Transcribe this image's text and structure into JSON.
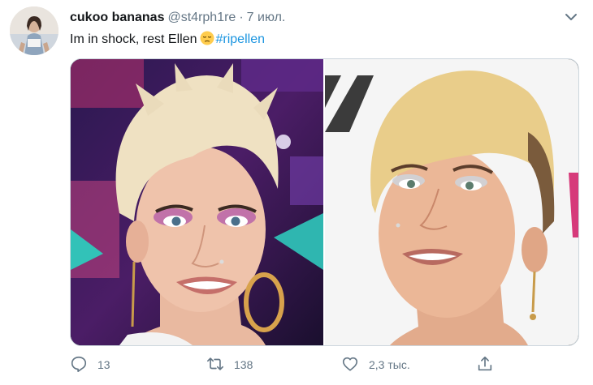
{
  "tweet": {
    "author_name": "cukoo bananas",
    "handle": "@st4rph1re",
    "separator": "·",
    "time": "7 июл.",
    "text": "Im in shock, rest Ellen",
    "emoji": "pensive-face",
    "hashtag": "#ripellen"
  },
  "media": {
    "left_photo": "portrait-pink-eyeshadow-hoop-earring",
    "right_photo": "portrait-white-backdrop-silver-eyeshadow"
  },
  "actions": {
    "replies": "13",
    "retweets": "138",
    "likes": "2,3 тыс."
  },
  "colors": {
    "link": "#1b95e0",
    "secondary_text": "#657786",
    "border": "#ccd6dd"
  }
}
